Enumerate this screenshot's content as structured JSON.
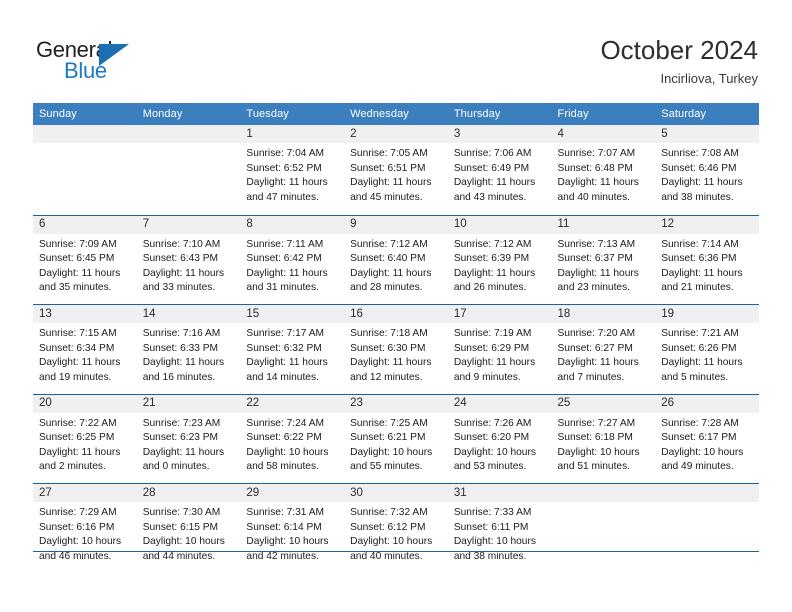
{
  "brand": {
    "name_part1": "General",
    "name_part2": "Blue",
    "triangle_icon": "triangle-logo-icon",
    "colors": {
      "dark": "#231f20",
      "blue": "#1f7bc1",
      "triangle": "#1b6fb3"
    }
  },
  "header": {
    "title": "October 2024",
    "subtitle": "Incirliova, Turkey"
  },
  "calendar": {
    "header_bg": "#3c7fbe",
    "row_divider": "#1b62a5",
    "daynum_band_bg": "#f0f0f0",
    "weekdays": [
      "Sunday",
      "Monday",
      "Tuesday",
      "Wednesday",
      "Thursday",
      "Friday",
      "Saturday"
    ],
    "weeks": [
      [
        {
          "day": "",
          "lines": []
        },
        {
          "day": "",
          "lines": []
        },
        {
          "day": "1",
          "lines": [
            "Sunrise: 7:04 AM",
            "Sunset: 6:52 PM",
            "Daylight: 11 hours",
            "and 47 minutes."
          ]
        },
        {
          "day": "2",
          "lines": [
            "Sunrise: 7:05 AM",
            "Sunset: 6:51 PM",
            "Daylight: 11 hours",
            "and 45 minutes."
          ]
        },
        {
          "day": "3",
          "lines": [
            "Sunrise: 7:06 AM",
            "Sunset: 6:49 PM",
            "Daylight: 11 hours",
            "and 43 minutes."
          ]
        },
        {
          "day": "4",
          "lines": [
            "Sunrise: 7:07 AM",
            "Sunset: 6:48 PM",
            "Daylight: 11 hours",
            "and 40 minutes."
          ]
        },
        {
          "day": "5",
          "lines": [
            "Sunrise: 7:08 AM",
            "Sunset: 6:46 PM",
            "Daylight: 11 hours",
            "and 38 minutes."
          ]
        }
      ],
      [
        {
          "day": "6",
          "lines": [
            "Sunrise: 7:09 AM",
            "Sunset: 6:45 PM",
            "Daylight: 11 hours",
            "and 35 minutes."
          ]
        },
        {
          "day": "7",
          "lines": [
            "Sunrise: 7:10 AM",
            "Sunset: 6:43 PM",
            "Daylight: 11 hours",
            "and 33 minutes."
          ]
        },
        {
          "day": "8",
          "lines": [
            "Sunrise: 7:11 AM",
            "Sunset: 6:42 PM",
            "Daylight: 11 hours",
            "and 31 minutes."
          ]
        },
        {
          "day": "9",
          "lines": [
            "Sunrise: 7:12 AM",
            "Sunset: 6:40 PM",
            "Daylight: 11 hours",
            "and 28 minutes."
          ]
        },
        {
          "day": "10",
          "lines": [
            "Sunrise: 7:12 AM",
            "Sunset: 6:39 PM",
            "Daylight: 11 hours",
            "and 26 minutes."
          ]
        },
        {
          "day": "11",
          "lines": [
            "Sunrise: 7:13 AM",
            "Sunset: 6:37 PM",
            "Daylight: 11 hours",
            "and 23 minutes."
          ]
        },
        {
          "day": "12",
          "lines": [
            "Sunrise: 7:14 AM",
            "Sunset: 6:36 PM",
            "Daylight: 11 hours",
            "and 21 minutes."
          ]
        }
      ],
      [
        {
          "day": "13",
          "lines": [
            "Sunrise: 7:15 AM",
            "Sunset: 6:34 PM",
            "Daylight: 11 hours",
            "and 19 minutes."
          ]
        },
        {
          "day": "14",
          "lines": [
            "Sunrise: 7:16 AM",
            "Sunset: 6:33 PM",
            "Daylight: 11 hours",
            "and 16 minutes."
          ]
        },
        {
          "day": "15",
          "lines": [
            "Sunrise: 7:17 AM",
            "Sunset: 6:32 PM",
            "Daylight: 11 hours",
            "and 14 minutes."
          ]
        },
        {
          "day": "16",
          "lines": [
            "Sunrise: 7:18 AM",
            "Sunset: 6:30 PM",
            "Daylight: 11 hours",
            "and 12 minutes."
          ]
        },
        {
          "day": "17",
          "lines": [
            "Sunrise: 7:19 AM",
            "Sunset: 6:29 PM",
            "Daylight: 11 hours",
            "and 9 minutes."
          ]
        },
        {
          "day": "18",
          "lines": [
            "Sunrise: 7:20 AM",
            "Sunset: 6:27 PM",
            "Daylight: 11 hours",
            "and 7 minutes."
          ]
        },
        {
          "day": "19",
          "lines": [
            "Sunrise: 7:21 AM",
            "Sunset: 6:26 PM",
            "Daylight: 11 hours",
            "and 5 minutes."
          ]
        }
      ],
      [
        {
          "day": "20",
          "lines": [
            "Sunrise: 7:22 AM",
            "Sunset: 6:25 PM",
            "Daylight: 11 hours",
            "and 2 minutes."
          ]
        },
        {
          "day": "21",
          "lines": [
            "Sunrise: 7:23 AM",
            "Sunset: 6:23 PM",
            "Daylight: 11 hours",
            "and 0 minutes."
          ]
        },
        {
          "day": "22",
          "lines": [
            "Sunrise: 7:24 AM",
            "Sunset: 6:22 PM",
            "Daylight: 10 hours",
            "and 58 minutes."
          ]
        },
        {
          "day": "23",
          "lines": [
            "Sunrise: 7:25 AM",
            "Sunset: 6:21 PM",
            "Daylight: 10 hours",
            "and 55 minutes."
          ]
        },
        {
          "day": "24",
          "lines": [
            "Sunrise: 7:26 AM",
            "Sunset: 6:20 PM",
            "Daylight: 10 hours",
            "and 53 minutes."
          ]
        },
        {
          "day": "25",
          "lines": [
            "Sunrise: 7:27 AM",
            "Sunset: 6:18 PM",
            "Daylight: 10 hours",
            "and 51 minutes."
          ]
        },
        {
          "day": "26",
          "lines": [
            "Sunrise: 7:28 AM",
            "Sunset: 6:17 PM",
            "Daylight: 10 hours",
            "and 49 minutes."
          ]
        }
      ],
      [
        {
          "day": "27",
          "lines": [
            "Sunrise: 7:29 AM",
            "Sunset: 6:16 PM",
            "Daylight: 10 hours",
            "and 46 minutes."
          ]
        },
        {
          "day": "28",
          "lines": [
            "Sunrise: 7:30 AM",
            "Sunset: 6:15 PM",
            "Daylight: 10 hours",
            "and 44 minutes."
          ]
        },
        {
          "day": "29",
          "lines": [
            "Sunrise: 7:31 AM",
            "Sunset: 6:14 PM",
            "Daylight: 10 hours",
            "and 42 minutes."
          ]
        },
        {
          "day": "30",
          "lines": [
            "Sunrise: 7:32 AM",
            "Sunset: 6:12 PM",
            "Daylight: 10 hours",
            "and 40 minutes."
          ]
        },
        {
          "day": "31",
          "lines": [
            "Sunrise: 7:33 AM",
            "Sunset: 6:11 PM",
            "Daylight: 10 hours",
            "and 38 minutes."
          ]
        },
        {
          "day": "",
          "lines": []
        },
        {
          "day": "",
          "lines": []
        }
      ]
    ]
  }
}
